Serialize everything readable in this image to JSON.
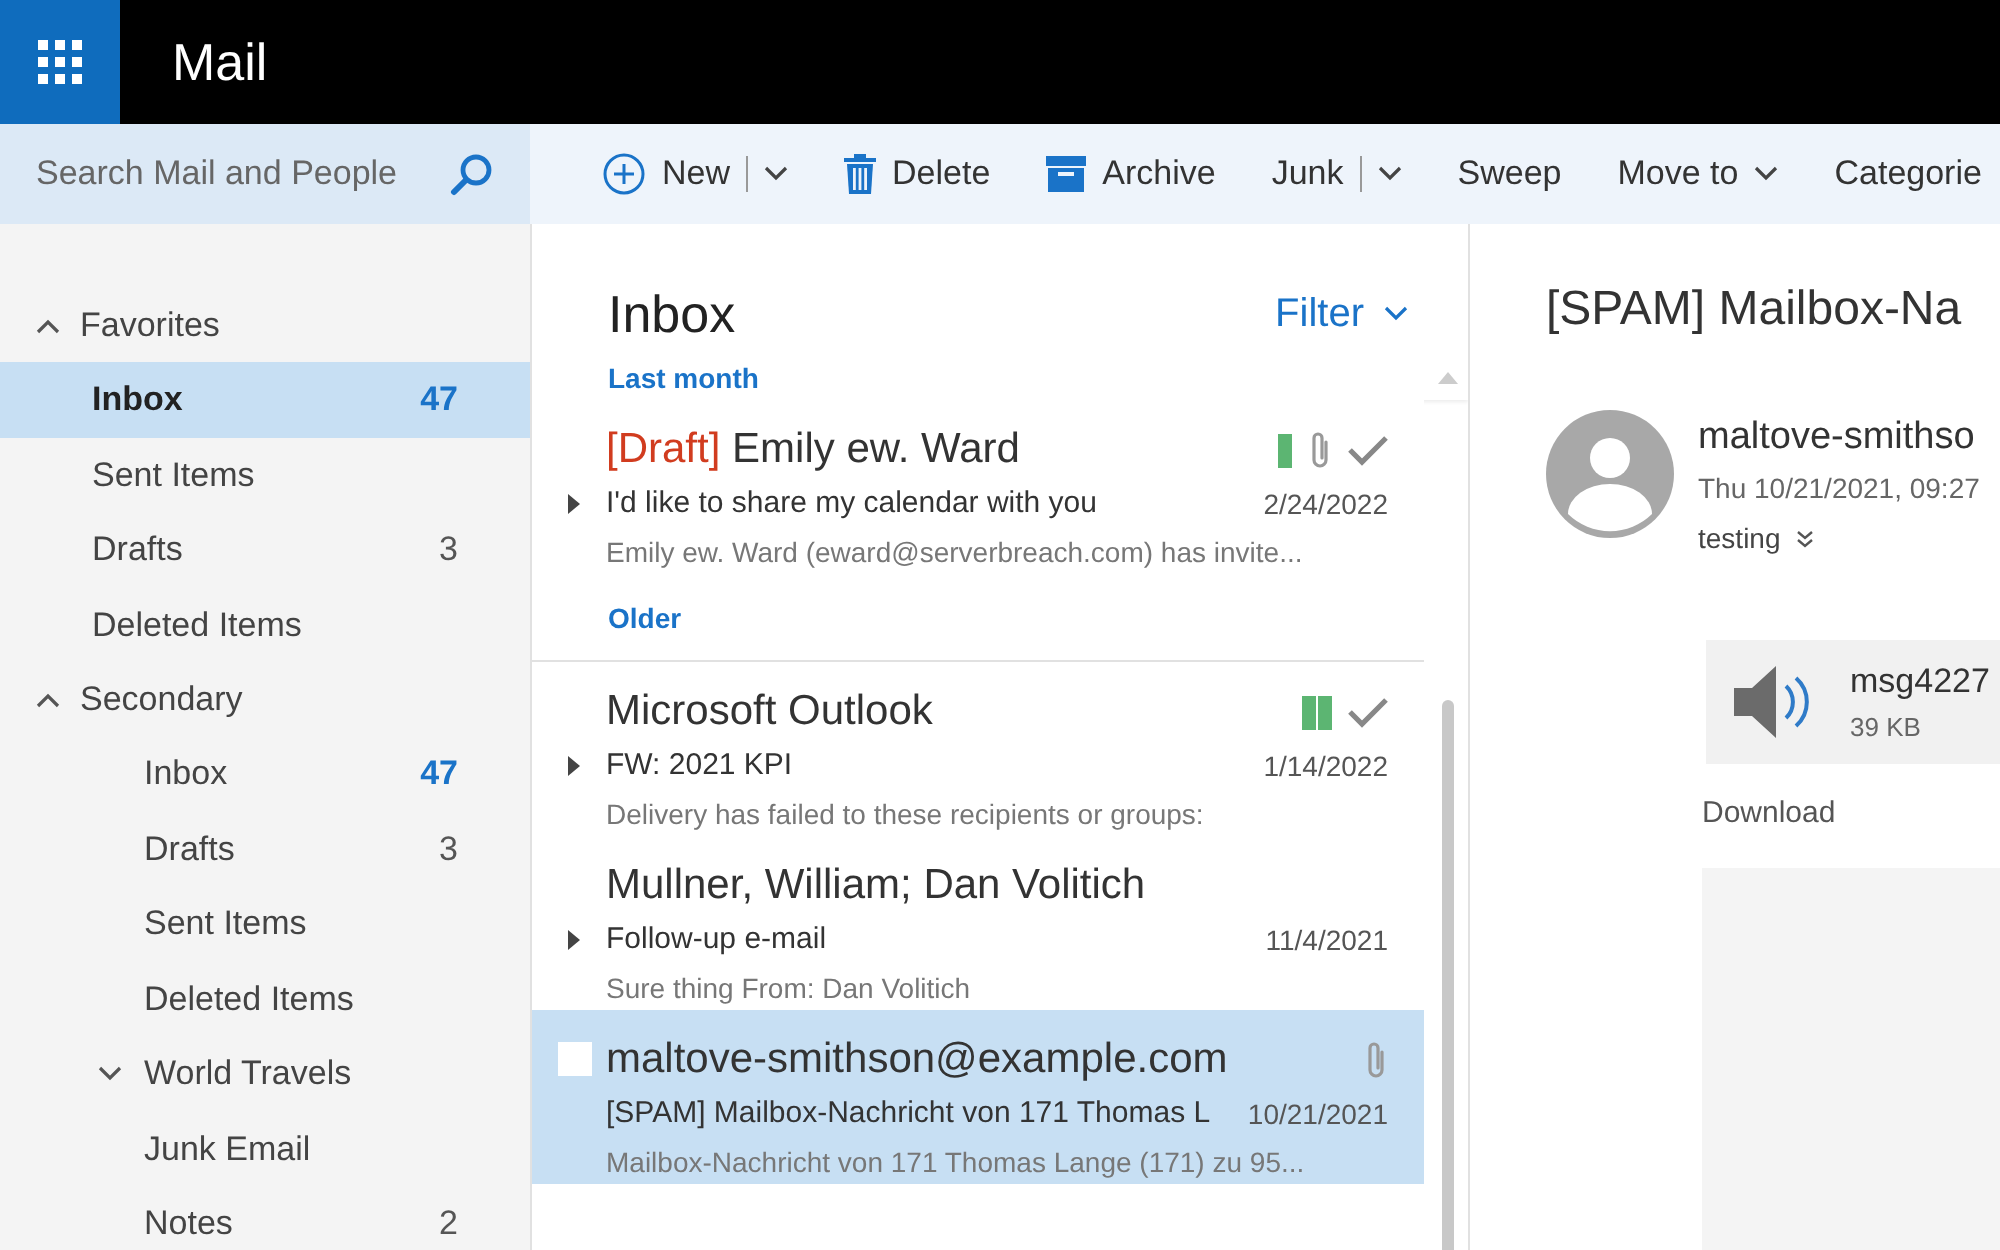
{
  "app": {
    "title": "Mail"
  },
  "search": {
    "placeholder": "Search Mail and People"
  },
  "toolbar": [
    {
      "label": "New",
      "kind": "new",
      "split": true
    },
    {
      "label": "Delete",
      "kind": "delete",
      "split": false
    },
    {
      "label": "Archive",
      "kind": "archive",
      "split": false
    },
    {
      "label": "Junk",
      "kind": "plain",
      "split": true
    },
    {
      "label": "Sweep",
      "kind": "plain",
      "split": false
    },
    {
      "label": "Move to",
      "kind": "menu",
      "split": false
    },
    {
      "label": "Categorie",
      "kind": "plain",
      "split": false
    }
  ],
  "sidebar": {
    "sections": [
      {
        "label": "Favorites",
        "expanded": true,
        "children": [
          {
            "label": "Inbox",
            "count": "47",
            "unread": true,
            "selected": true
          },
          {
            "label": "Sent Items",
            "selected": false
          },
          {
            "label": "Drafts",
            "count": "3",
            "unread": false,
            "selected": false
          },
          {
            "label": "Deleted Items",
            "selected": false
          }
        ]
      },
      {
        "label": "Secondary",
        "expanded": true,
        "children": [
          {
            "label": "Inbox",
            "count": "47",
            "unread": true,
            "selected": false
          },
          {
            "label": "Drafts",
            "count": "3",
            "unread": false,
            "selected": false
          },
          {
            "label": "Sent Items",
            "selected": false
          },
          {
            "label": "Deleted Items",
            "selected": false
          },
          {
            "label": "World Travels",
            "expanded": true,
            "selected": false
          },
          {
            "label": "Junk Email",
            "selected": false
          },
          {
            "label": "Notes",
            "count": "2",
            "unread": false,
            "selected": false
          }
        ]
      }
    ]
  },
  "message_list": {
    "title": "Inbox",
    "filter": "Filter",
    "groups": [
      {
        "label": "Last month",
        "messages": [
          {
            "draft_label": "[Draft]",
            "sender": "Emily ew. Ward",
            "subject": "I'd like to share my calendar with you",
            "date": "2/24/2022",
            "preview": "Emily ew. Ward (eward@serverbreach.com) has invite...",
            "categories": [
              {
                "color": "#5cb572"
              }
            ],
            "attachment": true,
            "done": true,
            "thread": true,
            "selected": false
          }
        ]
      },
      {
        "label": "Older",
        "messages": [
          {
            "sender": "Microsoft Outlook",
            "subject": "FW: 2021 KPI",
            "date": "1/14/2022",
            "preview": "Delivery has failed to these recipients or groups:",
            "categories": [
              {
                "color": "#5cb572"
              },
              {
                "color": "#5cb572"
              }
            ],
            "attachment": false,
            "done": true,
            "thread": true,
            "selected": false
          },
          {
            "sender": "Mullner, William; Dan Volitich",
            "subject": "Follow-up e-mail",
            "date": "11/4/2021",
            "preview": "Sure thing From: Dan Volitich",
            "attachment": false,
            "done": false,
            "thread": true,
            "selected": false
          },
          {
            "sender": "maltove-smithson@example.com",
            "subject": "[SPAM] Mailbox-Nachricht von 171 Thomas L",
            "date": "10/21/2021",
            "preview": "Mailbox-Nachricht von 171 Thomas Lange (171) zu 95...",
            "attachment": true,
            "done": false,
            "thread": false,
            "selected": true
          }
        ]
      }
    ]
  },
  "reading_pane": {
    "subject": "[SPAM] Mailbox-Na",
    "sender": "maltove-smithso",
    "date": "Thu 10/21/2021, 09:27",
    "to": "testing",
    "attachment": {
      "name": "msg4227",
      "size": "39 KB",
      "action": "Download"
    }
  }
}
